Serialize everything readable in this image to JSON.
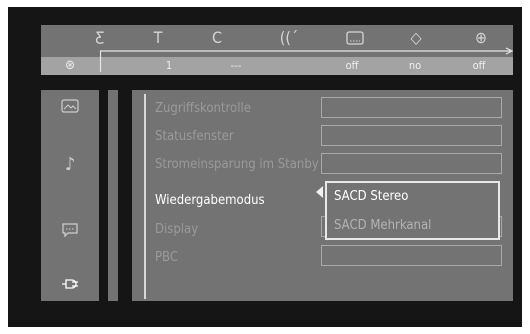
{
  "header": {
    "icons": [
      {
        "name": "audio-icon",
        "glyph": "Ƹ"
      },
      {
        "name": "title-icon",
        "glyph": "T"
      },
      {
        "name": "chapter-icon",
        "glyph": "C"
      },
      {
        "name": "sound-icon",
        "glyph": "((´"
      },
      {
        "name": "subtitle-icon",
        "glyph": "▭"
      },
      {
        "name": "angle-icon",
        "glyph": "◇"
      },
      {
        "name": "zoom-icon",
        "glyph": "⊕"
      }
    ],
    "disc_icon": "⊛",
    "values": [
      "1",
      "---",
      "off",
      "no",
      "off"
    ]
  },
  "sidebar": {
    "icons": [
      {
        "name": "picture-icon",
        "glyph": "▭"
      },
      {
        "name": "music-note-icon",
        "glyph": "♪"
      },
      {
        "name": "speech-bubble-icon",
        "glyph": "☐"
      },
      {
        "name": "plug-icon",
        "glyph": "⭠"
      }
    ]
  },
  "menu": {
    "items": [
      "Zugriffskontrolle",
      "Statusfenster",
      "Stromeinsparung im Stanby",
      "Wiedergabemodus",
      "Display",
      "PBC"
    ],
    "selected_index": 3
  },
  "dropdown": {
    "options": [
      "SACD  Stereo",
      "SACD  Mehrkanal"
    ]
  }
}
